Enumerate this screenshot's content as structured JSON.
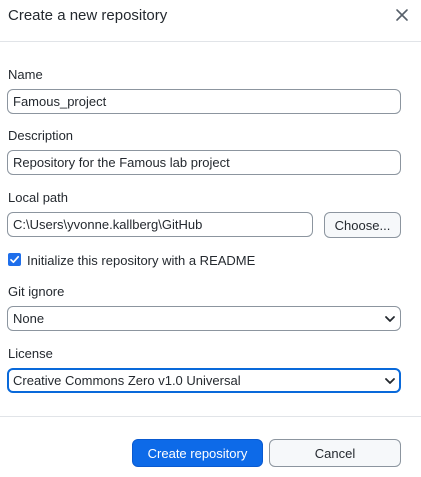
{
  "dialog": {
    "title": "Create a new repository",
    "close_icon": "close-icon"
  },
  "form": {
    "name": {
      "label": "Name",
      "value": "Famous_project"
    },
    "description": {
      "label": "Description",
      "value": "Repository for the Famous lab project"
    },
    "local_path": {
      "label": "Local path",
      "value": "C:\\Users\\yvonne.kallberg\\GitHub",
      "choose_label": "Choose..."
    },
    "readme": {
      "label": "Initialize this repository with a README",
      "checked": true
    },
    "git_ignore": {
      "label": "Git ignore",
      "selected": "None"
    },
    "license": {
      "label": "License",
      "selected": "Creative Commons Zero v1.0 Universal"
    }
  },
  "footer": {
    "create_label": "Create repository",
    "cancel_label": "Cancel"
  },
  "colors": {
    "primary_button": "#0d6ae8",
    "checkbox": "#1f6feb",
    "focus_border": "#0969da"
  }
}
